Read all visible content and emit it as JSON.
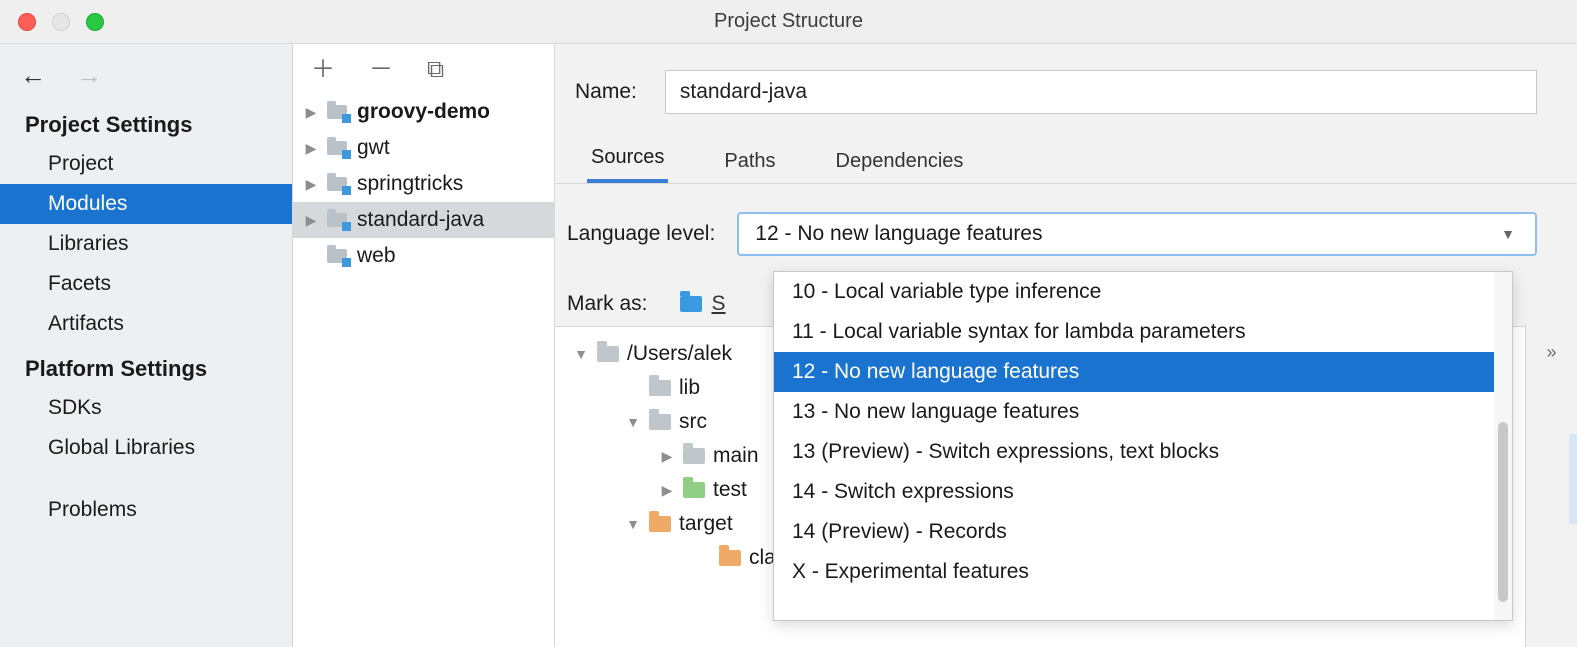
{
  "window": {
    "title": "Project Structure"
  },
  "sidebar": {
    "groups": [
      {
        "title": "Project Settings",
        "items": [
          {
            "label": "Project",
            "selected": false
          },
          {
            "label": "Modules",
            "selected": true
          },
          {
            "label": "Libraries",
            "selected": false
          },
          {
            "label": "Facets",
            "selected": false
          },
          {
            "label": "Artifacts",
            "selected": false
          }
        ]
      },
      {
        "title": "Platform Settings",
        "items": [
          {
            "label": "SDKs",
            "selected": false
          },
          {
            "label": "Global Libraries",
            "selected": false
          }
        ]
      }
    ],
    "footer_item": {
      "label": "Problems"
    }
  },
  "modules_panel": {
    "items": [
      {
        "label": "groovy-demo",
        "bold": true,
        "selected": false
      },
      {
        "label": "gwt",
        "bold": false,
        "selected": false
      },
      {
        "label": "springtricks",
        "bold": false,
        "selected": false
      },
      {
        "label": "standard-java",
        "bold": false,
        "selected": true
      },
      {
        "label": "web",
        "bold": false,
        "selected": false
      }
    ]
  },
  "details": {
    "name_label": "Name:",
    "name_value": "standard-java",
    "tabs": [
      {
        "label": "Sources",
        "active": true
      },
      {
        "label": "Paths",
        "active": false
      },
      {
        "label": "Dependencies",
        "active": false
      }
    ],
    "language_level_label": "Language level:",
    "language_level_value": "12 - No new language features",
    "language_level_options": [
      "10 - Local variable type inference",
      "11 - Local variable syntax for lambda parameters",
      "12 - No new language features",
      "13 - No new language features",
      "13 (Preview) - Switch expressions, text blocks",
      "14 - Switch expressions",
      "14 (Preview) - Records",
      "X - Experimental features"
    ],
    "language_level_selected_index": 2,
    "mark_as_label": "Mark as:",
    "mark_as_first_partial": "S",
    "expand_glyph": "»",
    "tree": {
      "root_label": "/Users/alek",
      "nodes": [
        {
          "label": "lib",
          "color": "gray",
          "indent": 2,
          "expandable": false
        },
        {
          "label": "src",
          "color": "gray",
          "indent": 2,
          "expandable": true,
          "expanded": true
        },
        {
          "label": "main",
          "color": "gray",
          "indent": 3,
          "expandable": true,
          "expanded": false
        },
        {
          "label": "test",
          "color": "green",
          "indent": 3,
          "expandable": true,
          "expanded": false
        },
        {
          "label": "target",
          "color": "orange",
          "indent": 2,
          "expandable": true,
          "expanded": true
        },
        {
          "label": "class",
          "color": "orange",
          "indent": 4,
          "expandable": false
        }
      ]
    }
  }
}
